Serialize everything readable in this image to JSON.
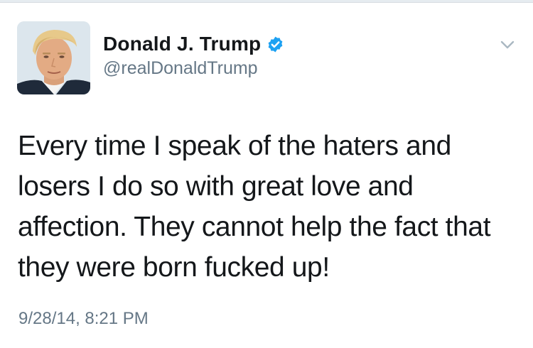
{
  "colors": {
    "text_primary": "#14171a",
    "text_secondary": "#657786",
    "verified_blue": "#1da1f2",
    "background": "#ffffff"
  },
  "user": {
    "display_name": "Donald J. Trump",
    "handle": "@realDonaldTrump",
    "verified": true,
    "avatar_icon": "profile-photo"
  },
  "menu": {
    "icon": "chevron-down-icon"
  },
  "tweet": {
    "text": "Every time I speak of the haters and\nlosers I do so with great love and\naffection. They cannot help the fact that\nthey were born fucked up!",
    "timestamp": "9/28/14, 8:21 PM"
  }
}
